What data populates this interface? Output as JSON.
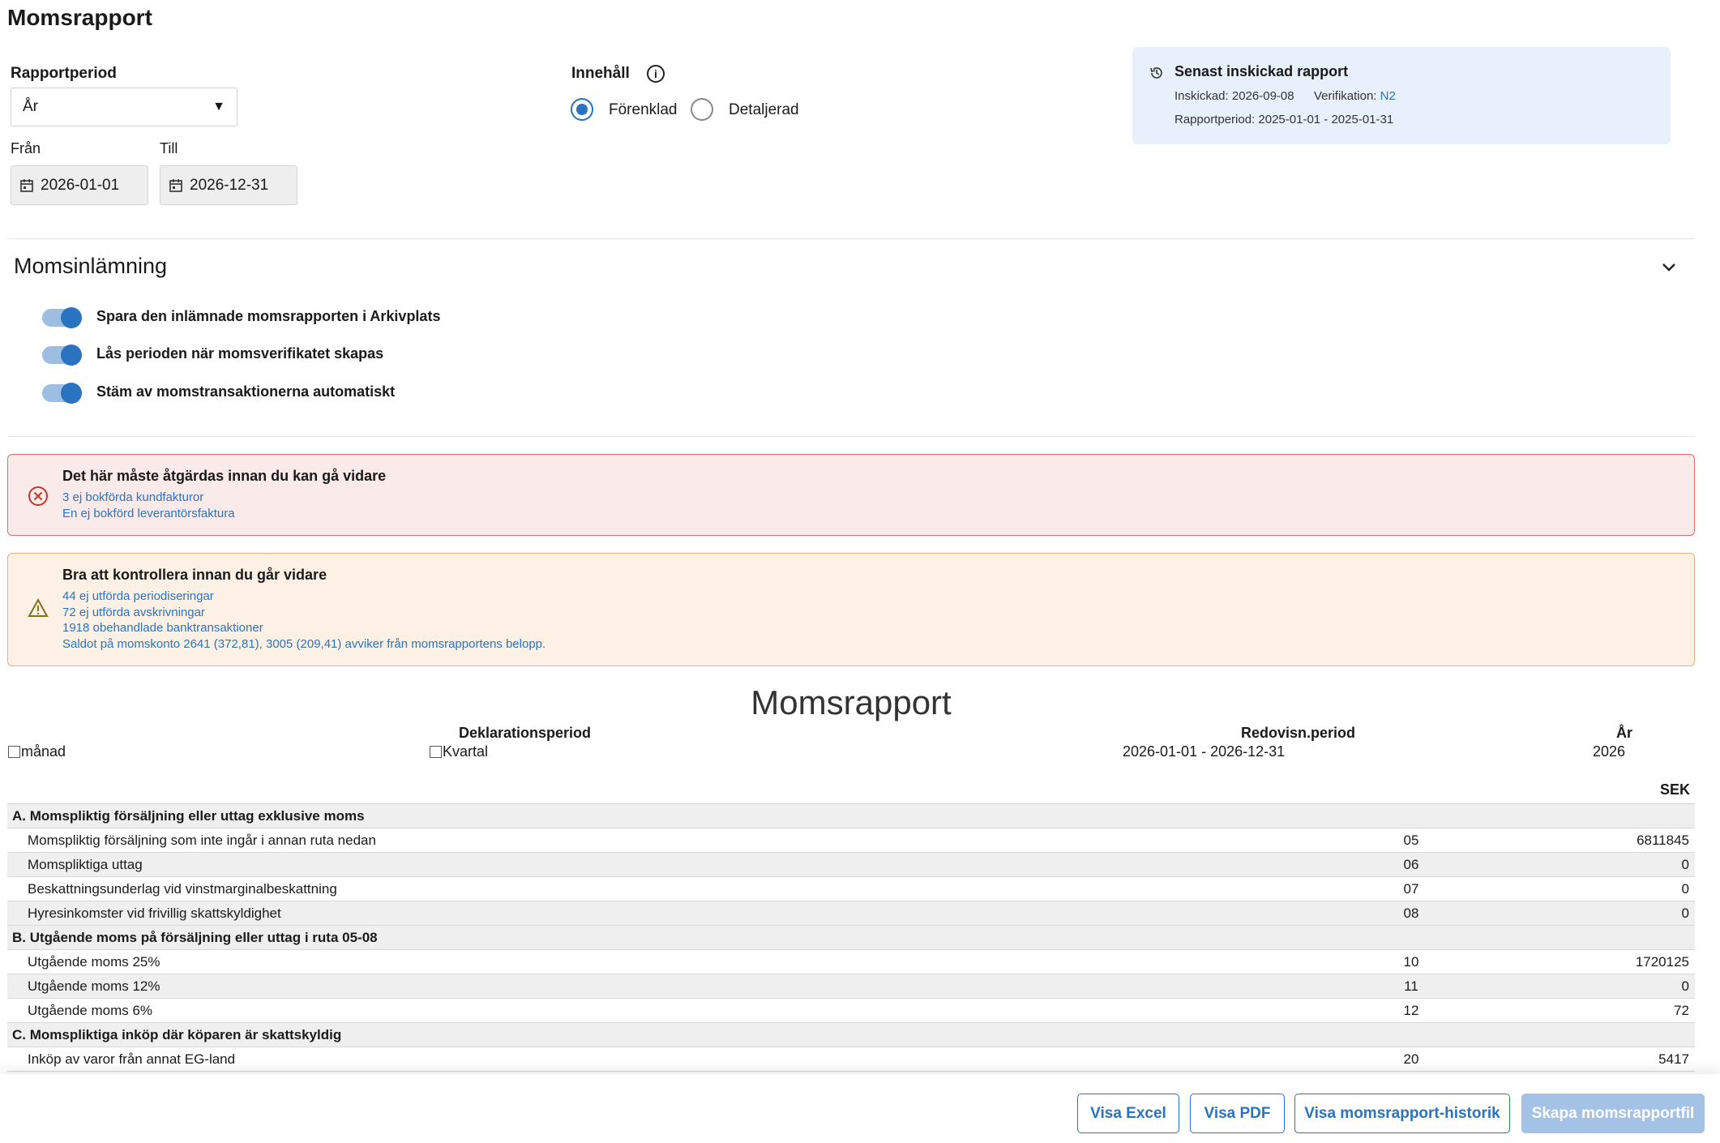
{
  "page": {
    "title": "Momsrapport"
  },
  "period": {
    "label": "Rapportperiod",
    "selected": "År",
    "from_label": "Från",
    "to_label": "Till",
    "from_value": "2026-01-01",
    "to_value": "2026-12-31"
  },
  "content": {
    "label": "Innehåll",
    "options": [
      "Förenklad",
      "Detaljerad"
    ],
    "selected": "Förenklad"
  },
  "last_report": {
    "title": "Senast inskickad rapport",
    "submitted": "Inskickad: 2026-09-08",
    "verification_label": "Verifikation:",
    "verification_value": "N2",
    "period": "Rapportperiod: 2025-01-01 - 2025-01-31"
  },
  "submission": {
    "title": "Momsinlämning",
    "toggles": [
      {
        "label": "Spara den inlämnade momsrapporten i Arkivplats",
        "on": true
      },
      {
        "label": "Lås perioden när momsverifikatet skapas",
        "on": true
      },
      {
        "label": "Stäm av momstransaktionerna automatiskt",
        "on": true
      }
    ]
  },
  "alerts": {
    "error": {
      "title": "Det här måste åtgärdas innan du kan gå vidare",
      "links": [
        "3 ej bokförda kundfakturor",
        "En ej bokförd leverantörsfaktura"
      ]
    },
    "warning": {
      "title": "Bra att kontrollera innan du går vidare",
      "links": [
        "44 ej utförda periodiseringar",
        "72 ej utförda avskrivningar",
        "1918 obehandlade banktransaktioner",
        "Saldot på momskonto 2641 (372,81), 3005 (209,41) avviker från momsrapportens belopp."
      ]
    }
  },
  "report": {
    "title": "Momsrapport",
    "declaration_period_label": "Deklarationsperiod",
    "month_label": "månad",
    "quarter_label": "Kvartal",
    "accounting_period_label": "Redovisn.period",
    "accounting_period_value": "2026-01-01 - 2026-12-31",
    "year_label": "År",
    "year_value": "2026",
    "currency": "SEK",
    "rows": [
      {
        "type": "section",
        "label": "A. Momspliktig försäljning eller uttag exklusive moms"
      },
      {
        "type": "row",
        "label": "Momspliktig försäljning som inte ingår i annan ruta nedan",
        "code": "05",
        "value": "6811845"
      },
      {
        "type": "row",
        "label": "Momspliktiga uttag",
        "code": "06",
        "value": "0"
      },
      {
        "type": "row",
        "label": "Beskattningsunderlag vid vinstmarginalbeskattning",
        "code": "07",
        "value": "0"
      },
      {
        "type": "row",
        "label": "Hyresinkomster vid frivillig skattskyldighet",
        "code": "08",
        "value": "0"
      },
      {
        "type": "section",
        "label": "B. Utgående moms på försäljning eller uttag i ruta 05-08"
      },
      {
        "type": "row",
        "label": "Utgående moms 25%",
        "code": "10",
        "value": "1720125"
      },
      {
        "type": "row",
        "label": "Utgående moms 12%",
        "code": "11",
        "value": "0"
      },
      {
        "type": "row",
        "label": "Utgående moms 6%",
        "code": "12",
        "value": "72"
      },
      {
        "type": "section",
        "label": "C. Momspliktiga inköp där köparen är skattskyldig"
      },
      {
        "type": "row",
        "label": "Inköp av varor från annat EG-land",
        "code": "20",
        "value": "5417"
      }
    ]
  },
  "footer": {
    "buttons": [
      "Visa Excel",
      "Visa PDF",
      "Visa momsrapport-historik",
      "Skapa momsrapportfil"
    ]
  },
  "colors": {
    "accent": "#2a73c0",
    "error_border": "#de6d6d",
    "warning_border": "#e5b07a",
    "panel_bg": "#e8f0fb"
  }
}
